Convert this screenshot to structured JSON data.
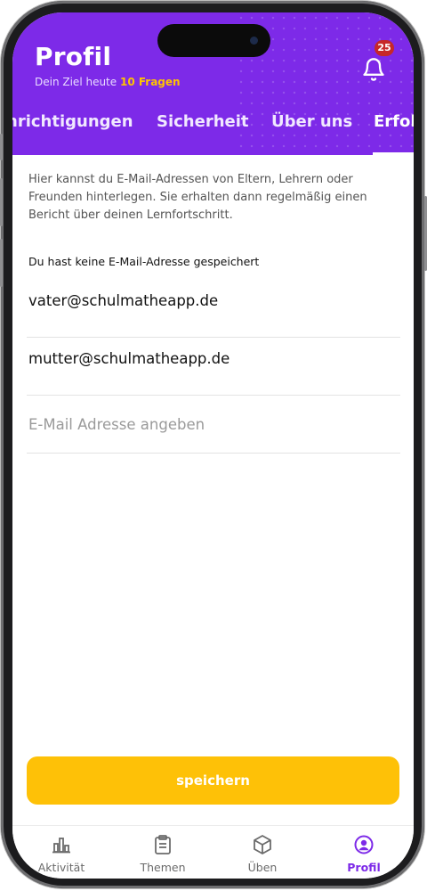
{
  "header": {
    "title": "Profil",
    "subtitle_prefix": "Dein Ziel heute",
    "subtitle_highlight": "10 Fragen",
    "notification_count": "25",
    "icon": "bell-icon"
  },
  "tabs": [
    {
      "label": "nrichtigungen"
    },
    {
      "label": "Sicherheit"
    },
    {
      "label": "Über uns"
    },
    {
      "label": "Erfol",
      "active": true
    }
  ],
  "content": {
    "description": "Hier kannst du E-Mail-Adressen von Eltern, Lehrern oder Freunden hinterlegen. Sie erhalten dann regelmäßig einen Bericht über deinen Lernfortschritt.",
    "empty_note": "Du hast keine E-Mail-Adresse gespeichert",
    "emails": [
      "vater@schulmatheapp.de",
      "mutter@schulmatheapp.de"
    ],
    "input_placeholder": "E-Mail Adresse angeben",
    "save_label": "speichern"
  },
  "nav": [
    {
      "label": "Aktivität",
      "icon": "bar-chart-icon"
    },
    {
      "label": "Themen",
      "icon": "clipboard-icon"
    },
    {
      "label": "Üben",
      "icon": "box-icon"
    },
    {
      "label": "Profil",
      "icon": "user-icon",
      "active": true
    }
  ],
  "colors": {
    "primary": "#7d2ae8",
    "accent": "#ffc400",
    "button": "#fec107",
    "badge": "#c62828"
  }
}
